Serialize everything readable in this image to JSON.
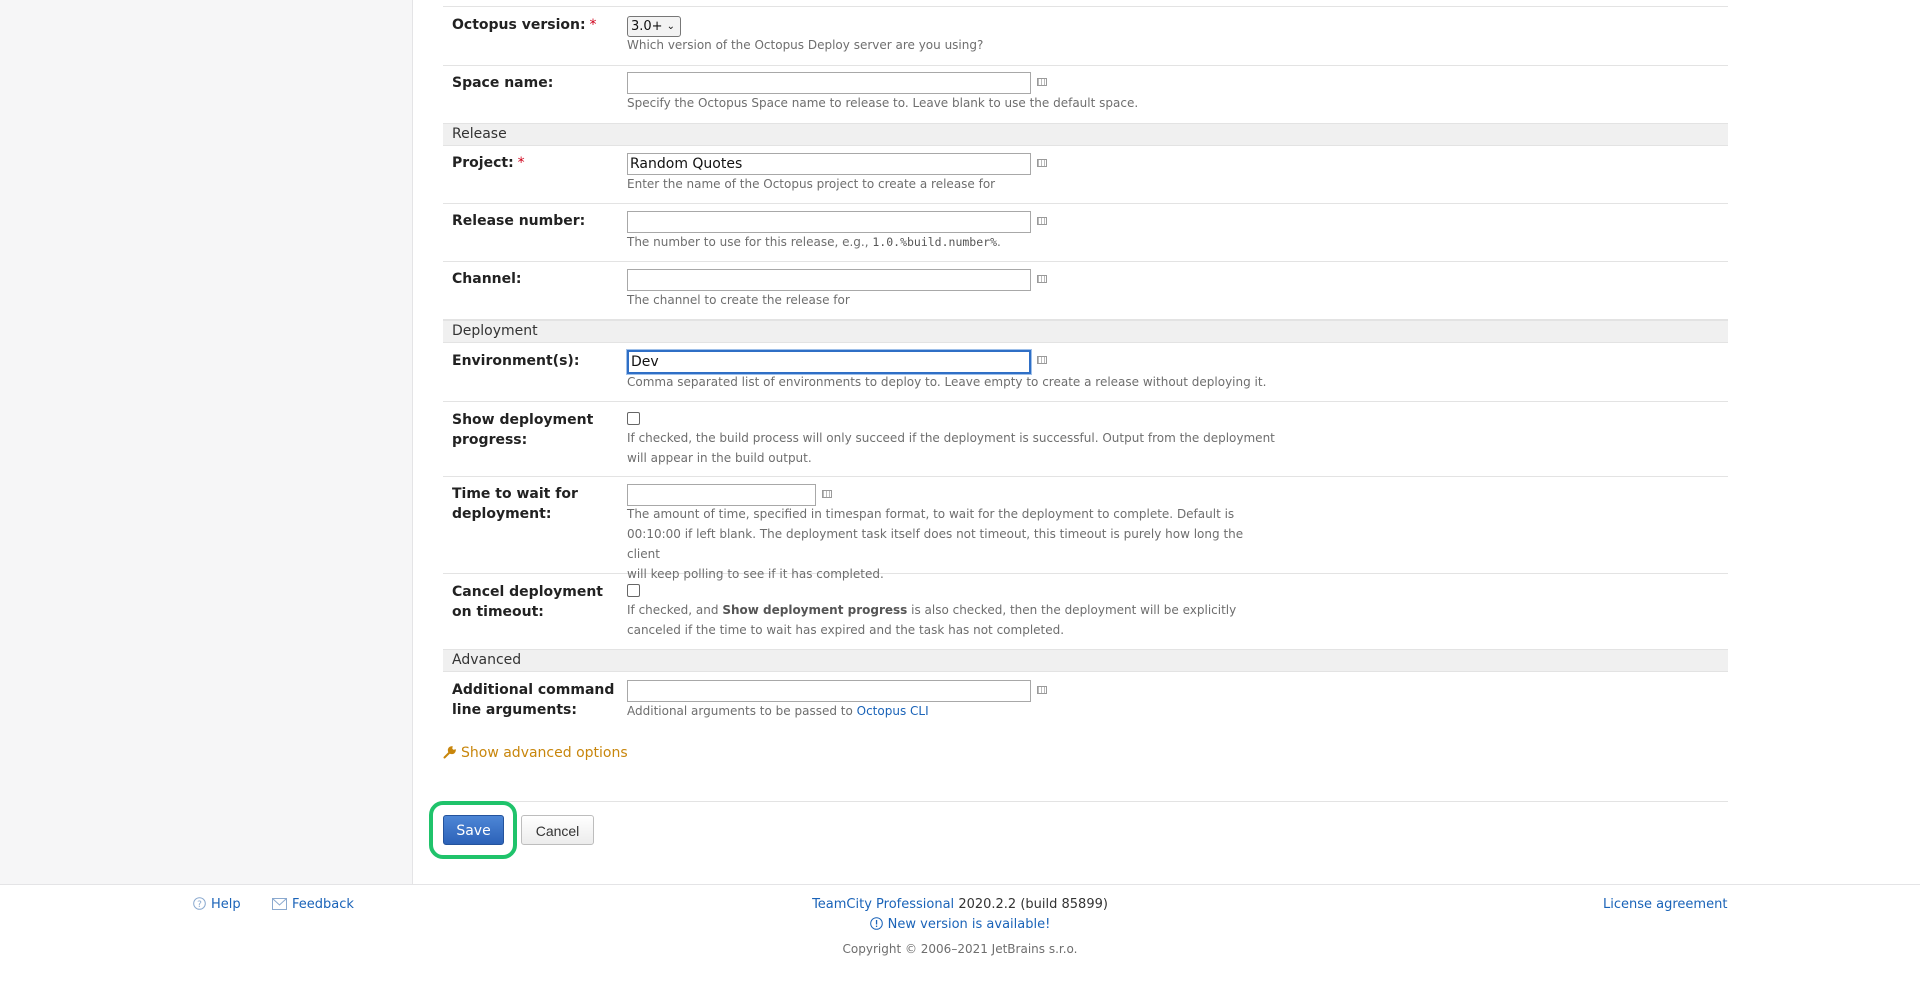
{
  "form": {
    "octopus_version": {
      "label": "Octopus version:",
      "required": "*",
      "value": "3.0+",
      "hint": "Which version of the Octopus Deploy server are you using?"
    },
    "space_name": {
      "label": "Space name:",
      "value": "",
      "hint": "Specify the Octopus Space name to release to. Leave blank to use the default space."
    },
    "release_section": "Release",
    "project": {
      "label": "Project:",
      "required": "*",
      "value": "Random Quotes",
      "hint": "Enter the name of the Octopus project to create a release for"
    },
    "release_number": {
      "label": "Release number:",
      "value": "",
      "hint_before": "The number to use for this release, e.g., ",
      "hint_code": "1.0.%build.number%",
      "hint_after": "."
    },
    "channel": {
      "label": "Channel:",
      "value": "",
      "hint": "The channel to create the release for"
    },
    "deployment_section": "Deployment",
    "environments": {
      "label": "Environment(s):",
      "value": "Dev",
      "hint": "Comma separated list of environments to deploy to. Leave empty to create a release without deploying it."
    },
    "show_progress": {
      "label_line1": "Show deployment",
      "label_line2": "progress:",
      "checked": false,
      "hint_line1": "If checked, the build process will only succeed if the deployment is successful. Output from the deployment",
      "hint_line2": "will appear in the build output."
    },
    "wait_time": {
      "label_line1": "Time to wait for",
      "label_line2": "deployment:",
      "value": "",
      "hint_line1": "The amount of time, specified in timespan format, to wait for the deployment to complete. Default is",
      "hint_line2": "00:10:00 if left blank. The deployment task itself does not timeout, this timeout is purely how long the client",
      "hint_line3": "will keep polling to see if it has completed."
    },
    "cancel_on_timeout": {
      "label_line1": "Cancel deployment",
      "label_line2": "on timeout:",
      "checked": false,
      "hint_line1_a": "If checked, and ",
      "hint_line1_b": "Show deployment progress",
      "hint_line1_c": " is also checked, then the deployment will be explicitly",
      "hint_line2": "canceled if the time to wait has expired and the task has not completed."
    },
    "advanced_section": "Advanced",
    "additional_args": {
      "label_line1": "Additional command",
      "label_line2": "line arguments:",
      "value": "",
      "hint": "Additional arguments to be passed to ",
      "hint_link": "Octopus CLI"
    },
    "show_advanced": "Show advanced options",
    "save_label": "Save",
    "cancel_label": "Cancel"
  },
  "footer": {
    "help": "Help",
    "feedback": "Feedback",
    "product": "TeamCity Professional",
    "version": "2020.2.2 (build 85899)",
    "new_version": "New version is available!",
    "license": "License agreement",
    "copyright": "Copyright © 2006–2021 JetBrains s.r.o."
  },
  "colors": {
    "accent": "#1a63b8",
    "highlight": "#1fc36b",
    "save": "#2c62b8",
    "required": "#d0021b",
    "advanced_link": "#c8860c"
  },
  "icons": [
    "parameter-picker-icon",
    "wrench-icon",
    "help-icon",
    "mail-icon",
    "info-icon",
    "chevron-down-icon"
  ]
}
